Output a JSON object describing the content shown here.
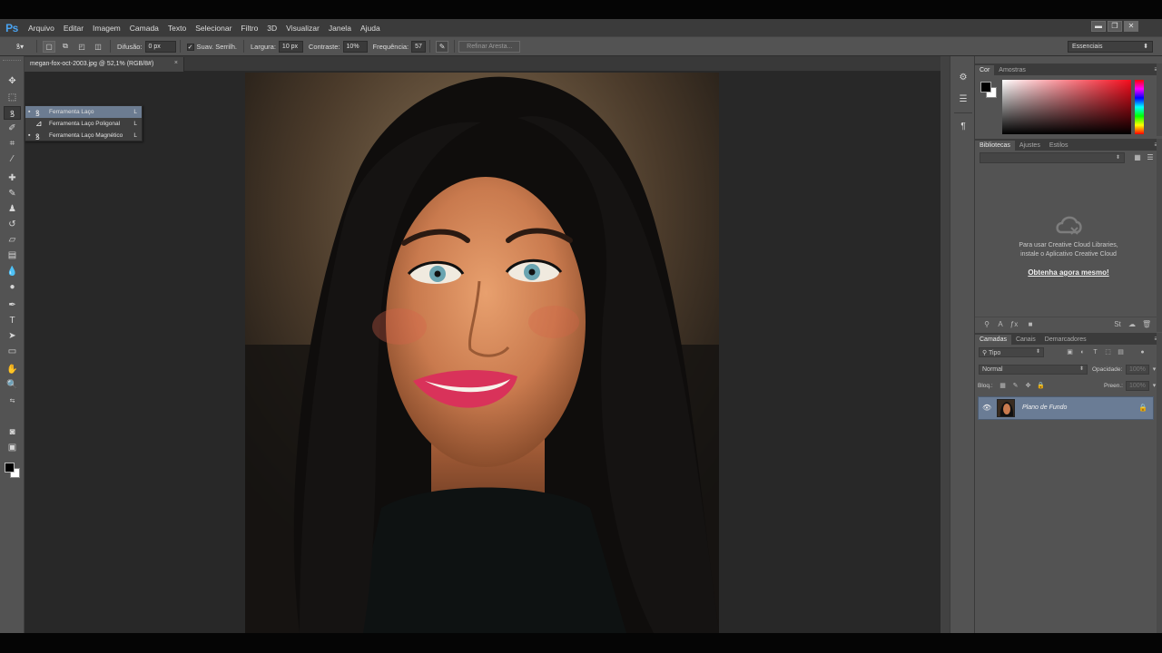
{
  "app": {
    "logo": "Ps",
    "menu": [
      "Arquivo",
      "Editar",
      "Imagem",
      "Camada",
      "Texto",
      "Selecionar",
      "Filtro",
      "3D",
      "Visualizar",
      "Janela",
      "Ajuda"
    ],
    "window_controls": [
      "▬",
      "❐",
      "✕"
    ]
  },
  "options_bar": {
    "tool_icon": "lasso-icon",
    "difusao_label": "Difusão:",
    "difusao_value": "0 px",
    "suav_label": "Suav. Serrilh.",
    "suav_checked": "✓",
    "largura_label": "Largura:",
    "largura_value": "10 px",
    "contraste_label": "Contraste:",
    "contraste_value": "10%",
    "frequencia_label": "Frequência:",
    "frequencia_value": "57",
    "refine_label": "Refinar Aresta...",
    "workspace": "Essenciais"
  },
  "document": {
    "tab_title": "megan-fox-oct-2003.jpg @ 52,1% (RGB/8#)",
    "tab_close": "×"
  },
  "flyout": {
    "items": [
      {
        "label": "Ferramenta Laço",
        "key": "L"
      },
      {
        "label": "Ferramenta Laço Poligonal",
        "key": "L"
      },
      {
        "label": "Ferramenta Laço Magnético",
        "key": "L"
      }
    ]
  },
  "color_panel": {
    "tabs": [
      "Cor",
      "Amostras"
    ],
    "foreground": "#000000",
    "background": "#ffffff",
    "hue": "#f50c1c"
  },
  "libraries_panel": {
    "tabs": [
      "Bibliotecas",
      "Ajustes",
      "Estilos"
    ],
    "message_line1": "Para usar Creative Cloud Libraries,",
    "message_line2": "instale o Aplicativo Creative Cloud",
    "link": "Obtenha agora mesmo!"
  },
  "layers_panel": {
    "tabs": [
      "Camadas",
      "Canais",
      "Demarcadores"
    ],
    "filter_label": "Tipo",
    "blend_mode": "Normal",
    "opacity_label": "Opacidade:",
    "opacity_value": "100%",
    "lock_label": "Bloq.:",
    "fill_label": "Preen.:",
    "fill_value": "100%",
    "layers": [
      {
        "name": "Plano de Fundo",
        "visible": true,
        "locked": true
      }
    ]
  }
}
